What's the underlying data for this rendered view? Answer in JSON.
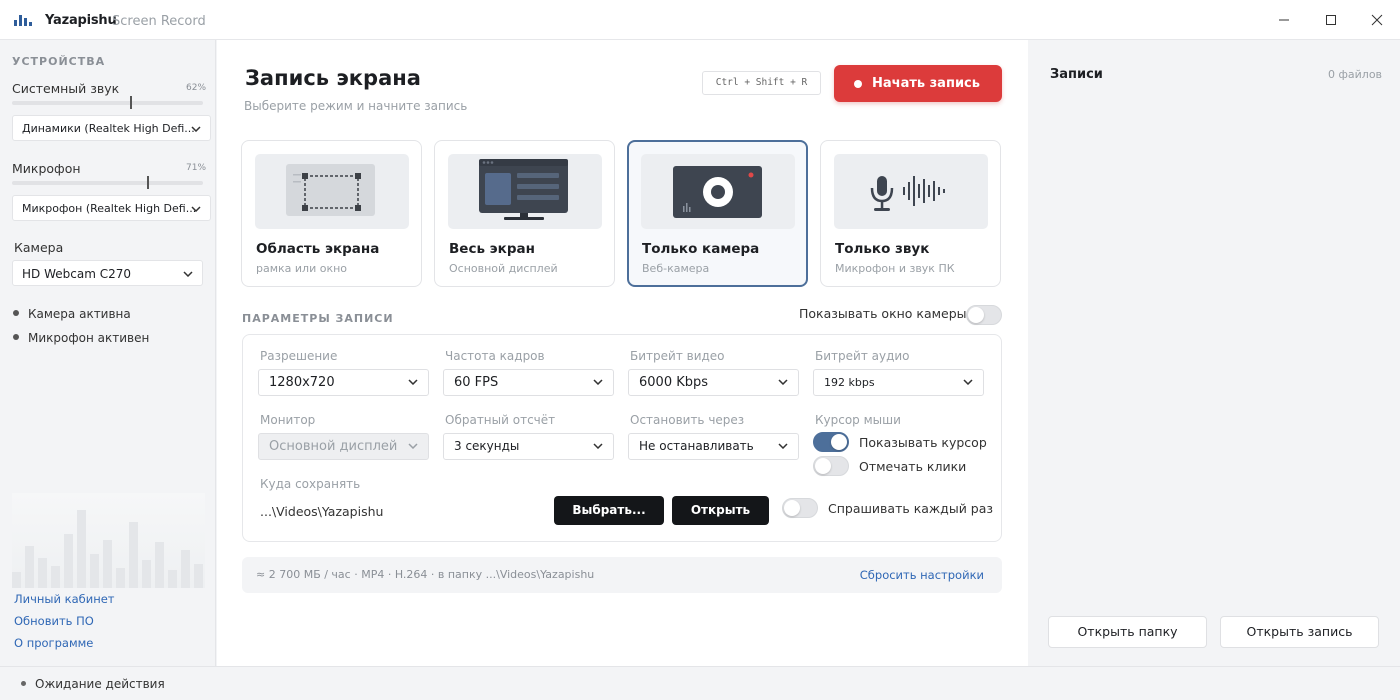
{
  "app": {
    "name": "Yazapishu",
    "subtitle": "Screen Record"
  },
  "window_controls": [
    "minimize-icon",
    "maximize-icon",
    "close-icon"
  ],
  "sidebar": {
    "section_title": "УСТРОЙСТВА",
    "system_audio": {
      "label": "Системный звук",
      "percent": "62%",
      "level": 0.62,
      "device": "Динамики (Realtek High Defi..."
    },
    "microphone": {
      "label": "Микрофон",
      "percent": "71%",
      "level": 0.71,
      "device": "Микрофон (Realtek High Defi..."
    },
    "camera": {
      "label": "Камера",
      "device": "HD Webcam C270"
    },
    "status": [
      "Камера активна",
      "Микрофон активен"
    ],
    "links": [
      "Личный кабинет",
      "Обновить ПО",
      "О программе"
    ]
  },
  "main": {
    "title": "Запись экрана",
    "subtitle": "Выберите режим и начните запись",
    "shortcut": "Ctrl + Shift + R",
    "record_button": "Начать запись",
    "modes": [
      {
        "title": "Область экрана",
        "sub": "рамка или окно",
        "icon": "region-select-icon",
        "selected": false
      },
      {
        "title": "Весь экран",
        "sub": "Основной дисплей",
        "icon": "monitor-icon",
        "selected": false
      },
      {
        "title": "Только камера",
        "sub": "Веб-камера",
        "icon": "camera-icon",
        "selected": true
      },
      {
        "title": "Только звук",
        "sub": "Микрофон и звук ПК",
        "icon": "microphone-wave-icon",
        "selected": false
      }
    ],
    "params_title": "ПАРАМЕТРЫ ЗАПИСИ",
    "show_camera_window": {
      "label": "Показывать окно камеры",
      "on": false
    },
    "fields": {
      "resolution": {
        "label": "Разрешение",
        "value": "1280x720"
      },
      "fps": {
        "label": "Частота кадров",
        "value": "60 FPS"
      },
      "video_bitrate": {
        "label": "Битрейт видео",
        "value": "6000 Kbps"
      },
      "audio_bitrate": {
        "label": "Битрейт аудио",
        "value": "192 kbps"
      },
      "monitor": {
        "label": "Монитор",
        "value": "Основной дисплей"
      },
      "countdown": {
        "label": "Обратный отсчёт",
        "value": "3 секунды"
      },
      "stop_after": {
        "label": "Остановить через",
        "value": "Не останавливать"
      },
      "cursor": {
        "label": "Курсор мыши",
        "show_cursor": "Показывать курсор",
        "mark_clicks": "Отмечать клики"
      },
      "save_to": {
        "label": "Куда сохранять",
        "path": "...\\Videos\\Yazapishu",
        "choose": "Выбрать...",
        "open": "Открыть",
        "ask_each": "Спрашивать каждый раз"
      }
    },
    "summary": "≈ 2 700 МБ / час · MP4 · H.264 · в папку ...\\Videos\\Yazapishu",
    "reset": "Сбросить настройки"
  },
  "recordings": {
    "title": "Записи",
    "count": "0 файлов",
    "open_folder": "Открыть папку",
    "open_record": "Открыть запись"
  },
  "statusbar": {
    "text": "Ожидание действия"
  },
  "colors": {
    "accent": "#4d6f9a",
    "record": "#dc3b3b",
    "link": "#2f67b5"
  }
}
